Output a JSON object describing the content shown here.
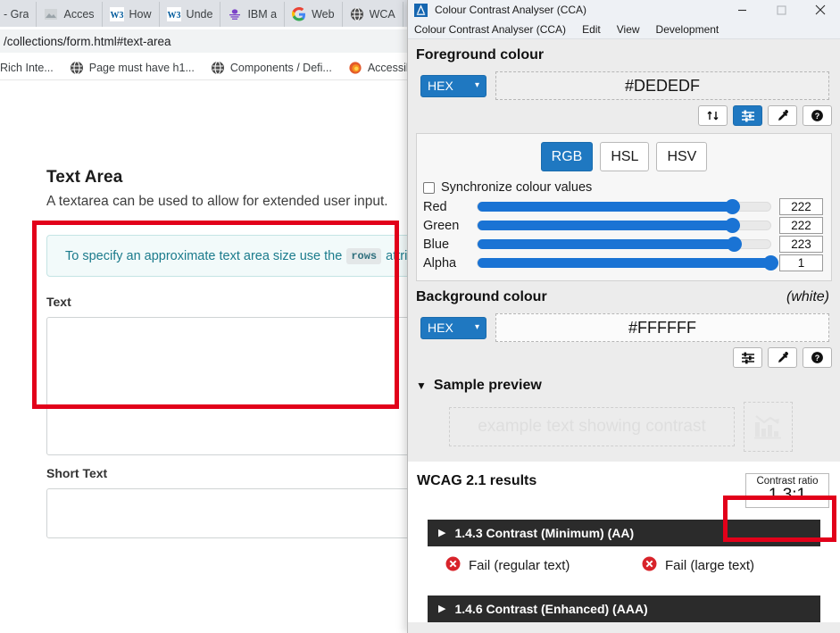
{
  "browser": {
    "tabs": [
      {
        "label": "- Gra",
        "icon": "none"
      },
      {
        "label": "Acces",
        "icon": "image-icon"
      },
      {
        "label": "How",
        "icon": "w3c-icon"
      },
      {
        "label": "Unde",
        "icon": "w3c-icon"
      },
      {
        "label": "IBM a",
        "icon": "ibm-icon"
      },
      {
        "label": "Web",
        "icon": "google-icon"
      },
      {
        "label": "WCA",
        "icon": "globe-icon"
      }
    ],
    "url": "/collections/form.html#text-area",
    "bookmarks": [
      {
        "label": "Rich Inte...",
        "icon": "none"
      },
      {
        "label": "Page must have h1...",
        "icon": "globe-icon"
      },
      {
        "label": "Components / Defi...",
        "icon": "globe-icon"
      },
      {
        "label": "Accessibility",
        "icon": "firefox-icon"
      }
    ]
  },
  "page": {
    "heading": "Text Area",
    "subheading": "A textarea can be used to allow for extended user input.",
    "callout_before": "To specify an approximate text area size use the",
    "callout_code": "rows",
    "callout_after": "attribute",
    "field_text_label": "Text",
    "field_short_label": "Short Text"
  },
  "cca": {
    "window_title": "Colour Contrast Analyser (CCA)",
    "menu": [
      "Colour Contrast Analyser (CCA)",
      "Edit",
      "View",
      "Development"
    ],
    "window_buttons": [
      "minimize-button",
      "maximize-button",
      "close-button"
    ],
    "foreground": {
      "heading": "Foreground colour",
      "format": "HEX",
      "value": "#DEDEDF",
      "buttons": [
        "swap-colours-icon",
        "sliders-icon",
        "eyedropper-icon",
        "help-icon"
      ]
    },
    "colour_modes": [
      "RGB",
      "HSL",
      "HSV"
    ],
    "colour_mode_selected": "RGB",
    "sync_label": "Synchronize colour values",
    "sync_checked": false,
    "sliders": [
      {
        "name": "Red",
        "value": "222",
        "percent": 87
      },
      {
        "name": "Green",
        "value": "222",
        "percent": 87
      },
      {
        "name": "Blue",
        "value": "223",
        "percent": 87.5
      },
      {
        "name": "Alpha",
        "value": "1",
        "percent": 100
      }
    ],
    "background": {
      "heading": "Background colour",
      "note": "(white)",
      "format": "HEX",
      "value": "#FFFFFF",
      "buttons": [
        "sliders-icon",
        "eyedropper-icon",
        "help-icon"
      ]
    },
    "sample_preview": {
      "heading": "Sample preview",
      "expanded": true,
      "text": "example text showing contrast",
      "icon": "bar-chart-icon"
    },
    "results": {
      "heading": "WCAG 2.1 results",
      "ratio_label": "Contrast ratio",
      "ratio_value": "1.3:1",
      "criteria": [
        {
          "title": "1.4.3 Contrast (Minimum) (AA)",
          "expanded": false,
          "results": [
            {
              "status": "Fail",
              "text": "Fail (regular text)"
            },
            {
              "status": "Fail",
              "text": "Fail (large text)"
            }
          ]
        },
        {
          "title": "1.4.6 Contrast (Enhanced) (AAA)",
          "expanded": false,
          "results": []
        }
      ]
    }
  },
  "colors": {
    "accent_blue": "#1f78c1",
    "slider_blue": "#1a73d4",
    "fail_red": "#d8232a",
    "annotation_red": "#e2001a",
    "criterion_bar": "#2b2b2b",
    "callout_teal": "#1b7b8c"
  }
}
